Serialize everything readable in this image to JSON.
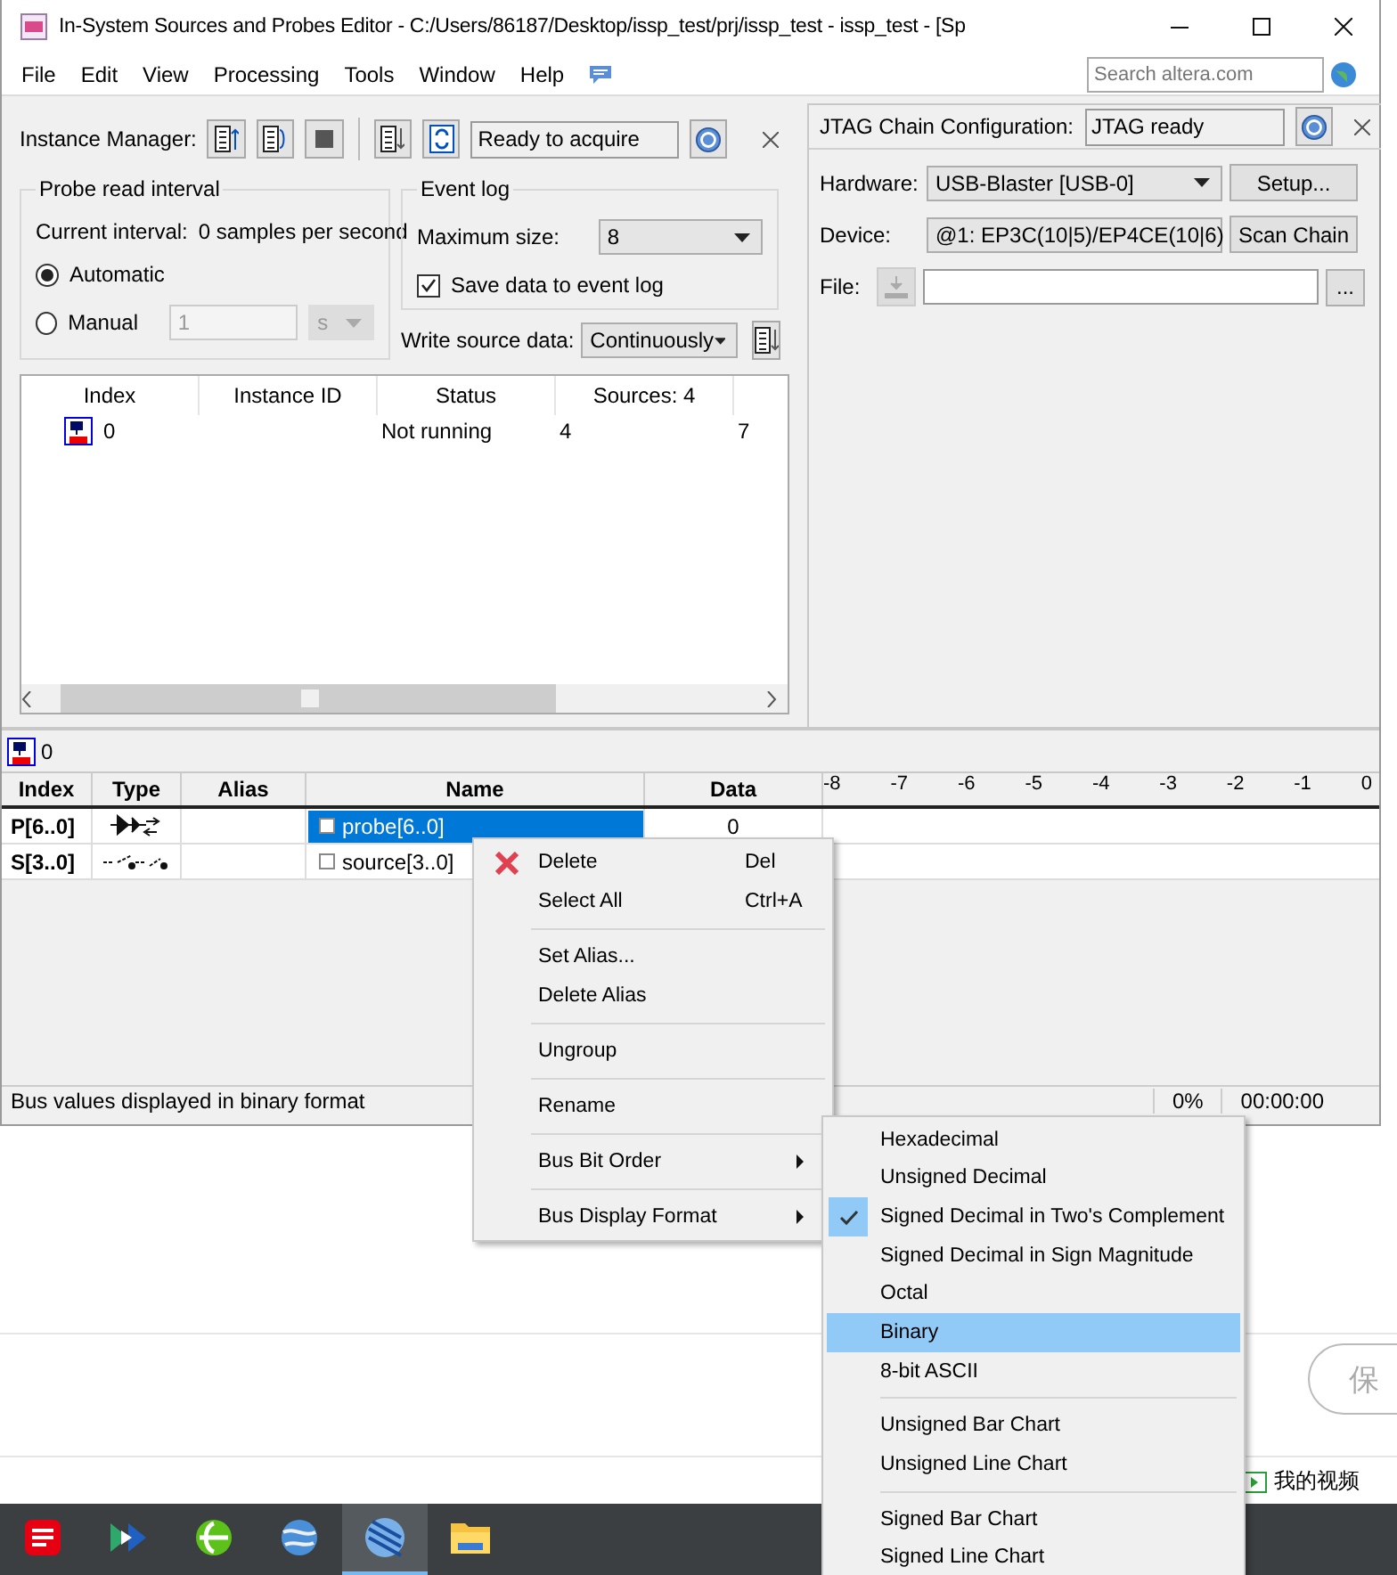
{
  "window": {
    "title": "In-System Sources and Probes Editor - C:/Users/86187/Desktop/issp_test/prj/issp_test - issp_test - [Sp"
  },
  "menu": [
    "File",
    "Edit",
    "View",
    "Processing",
    "Tools",
    "Window",
    "Help"
  ],
  "search": {
    "placeholder": "Search altera.com"
  },
  "instance_manager": {
    "label": "Instance Manager:",
    "status": "Ready to acquire"
  },
  "probe_interval": {
    "title": "Probe read interval",
    "current_label": "Current interval:",
    "current_value": "0 samples per second",
    "options": [
      {
        "label": "Automatic",
        "selected": true
      },
      {
        "label": "Manual",
        "selected": false
      }
    ],
    "manual": {
      "value": "1",
      "unit": "s",
      "disabled": true
    }
  },
  "event_log": {
    "title": "Event log",
    "max_label": "Maximum size:",
    "max_value": "8",
    "save": {
      "label": "Save data to event log",
      "checked": true
    }
  },
  "write_source": {
    "label": "Write source data:",
    "value": "Continuously"
  },
  "instance_table": {
    "columns": [
      "Index",
      "Instance ID",
      "Status",
      "Sources: 4"
    ],
    "rows": [
      {
        "cells": [
          "0",
          "",
          "Not running",
          "4",
          "7"
        ]
      }
    ]
  },
  "jtag": {
    "label": "JTAG Chain Configuration:",
    "status": "JTAG ready",
    "hardware_label": "Hardware:",
    "hardware": "USB-Blaster [USB-0]",
    "setup": "Setup...",
    "device_label": "Device:",
    "device": "@1: EP3C(10|5)/EP4CE(10|6)",
    "scan": "Scan Chain",
    "file_label": "File:",
    "browse": "..."
  },
  "signal_panel": {
    "instance": "0",
    "columns": [
      "Index",
      "Type",
      "Alias",
      "Name",
      "Data"
    ],
    "ticks": [
      "-8",
      "-7",
      "-6",
      "-5",
      "-4",
      "-3",
      "-2",
      "-1",
      "0"
    ],
    "rows": [
      {
        "index": "P[6..0]",
        "kind": "probe",
        "name": "probe[6..0]",
        "data": "0",
        "selected": true
      },
      {
        "index": "S[3..0]",
        "kind": "source",
        "name": "source[3..0]",
        "data": "",
        "selected": false
      }
    ]
  },
  "status_bar": {
    "message": "Bus values displayed in binary format",
    "percent": "0%",
    "time": "00:00:00"
  },
  "context_menu": {
    "groups": [
      [
        {
          "label": "Delete",
          "shortcut": "Del",
          "kind": "delete"
        },
        {
          "label": "Select All",
          "shortcut": "Ctrl+A",
          "kind": "plain"
        }
      ],
      [
        {
          "label": "Set Alias...",
          "kind": "plain"
        },
        {
          "label": "Delete Alias",
          "kind": "plain"
        }
      ],
      [
        {
          "label": "Ungroup",
          "kind": "plain"
        }
      ],
      [
        {
          "label": "Rename",
          "kind": "plain"
        }
      ],
      [
        {
          "label": "Bus Bit Order",
          "kind": "submenu"
        }
      ],
      [
        {
          "label": "Bus Display Format",
          "kind": "submenu"
        }
      ]
    ]
  },
  "format_menu": {
    "groups": [
      [
        {
          "label": "Hexadecimal",
          "checked": false,
          "selected": false
        },
        {
          "label": "Unsigned Decimal",
          "checked": false,
          "selected": false
        },
        {
          "label": "Signed Decimal in Two's Complement",
          "checked": true,
          "selected": false
        },
        {
          "label": "Signed Decimal in Sign Magnitude",
          "checked": false,
          "selected": false
        },
        {
          "label": "Octal",
          "checked": false,
          "selected": false
        },
        {
          "label": "Binary",
          "checked": false,
          "selected": true
        },
        {
          "label": "8-bit ASCII",
          "checked": false,
          "selected": false
        }
      ],
      [
        {
          "label": "Unsigned Bar Chart",
          "checked": false,
          "selected": false
        },
        {
          "label": "Unsigned Line Chart",
          "checked": false,
          "selected": false
        }
      ],
      [
        {
          "label": "Signed Bar Chart",
          "checked": false,
          "selected": false
        },
        {
          "label": "Signed Line Chart",
          "checked": false,
          "selected": false
        }
      ]
    ]
  },
  "background": {
    "button": "保",
    "link": "我的视频"
  },
  "taskbar": {
    "apps": [
      {
        "kind": "red"
      },
      {
        "kind": "dict"
      },
      {
        "kind": "diamond"
      },
      {
        "kind": "browser"
      },
      {
        "kind": "quartus",
        "selected": true
      },
      {
        "kind": "folder"
      }
    ]
  }
}
